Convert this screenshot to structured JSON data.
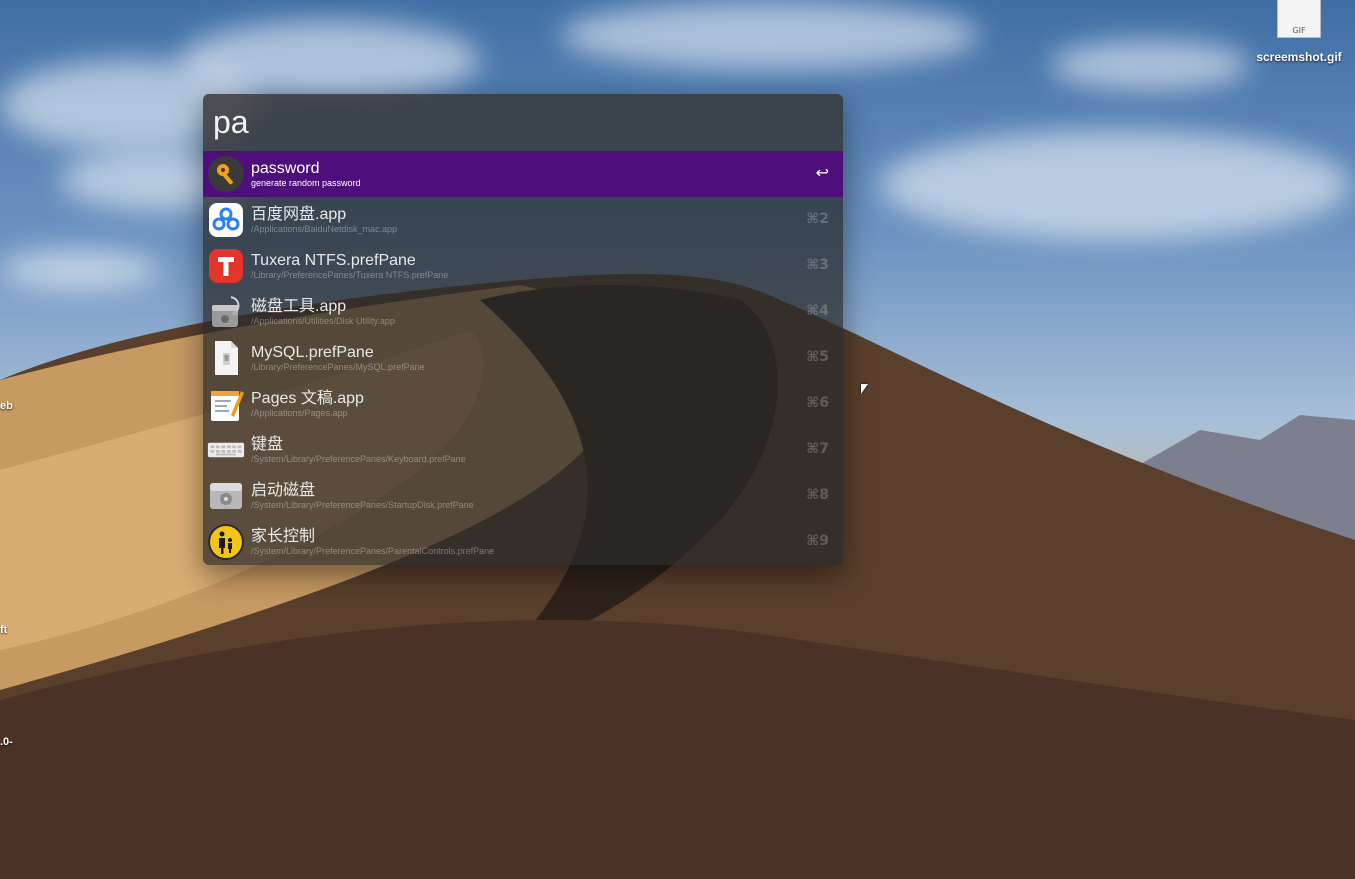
{
  "desktop": {
    "file_icon_caption": "GIF",
    "file_name": "screemshot.gif",
    "edge_labels": [
      "eb",
      "ft",
      ".0-"
    ]
  },
  "launcher": {
    "query": "pa",
    "accent_color": "#4e0f7a",
    "results": [
      {
        "title": "password",
        "subtitle": "generate random password",
        "shortcut": "↩",
        "icon": "key-icon",
        "selected": true
      },
      {
        "title": "百度网盘.app",
        "subtitle": "/Applications/BaiduNetdisk_mac.app",
        "shortcut": "⌘2",
        "icon": "baidu-netdisk-icon"
      },
      {
        "title": "Tuxera NTFS.prefPane",
        "subtitle": "/Library/PreferencePanes/Tuxera NTFS.prefPane",
        "shortcut": "⌘3",
        "icon": "tuxera-icon"
      },
      {
        "title": "磁盘工具.app",
        "subtitle": "/Applications/Utilities/Disk Utility.app",
        "shortcut": "⌘4",
        "icon": "disk-utility-icon"
      },
      {
        "title": "MySQL.prefPane",
        "subtitle": "/Library/PreferencePanes/MySQL.prefPane",
        "shortcut": "⌘5",
        "icon": "document-icon"
      },
      {
        "title": "Pages 文稿.app",
        "subtitle": "/Applications/Pages.app",
        "shortcut": "⌘6",
        "icon": "pages-icon"
      },
      {
        "title": "键盘",
        "subtitle": "/System/Library/PreferencePanes/Keyboard.prefPane",
        "shortcut": "⌘7",
        "icon": "keyboard-icon"
      },
      {
        "title": "启动磁盘",
        "subtitle": "/System/Library/PreferencePanes/StartupDisk.prefPane",
        "shortcut": "⌘8",
        "icon": "startup-disk-icon"
      },
      {
        "title": "家长控制",
        "subtitle": "/System/Library/PreferencePanes/ParentalControls.prefPane",
        "shortcut": "⌘9",
        "icon": "parental-controls-icon"
      }
    ]
  }
}
